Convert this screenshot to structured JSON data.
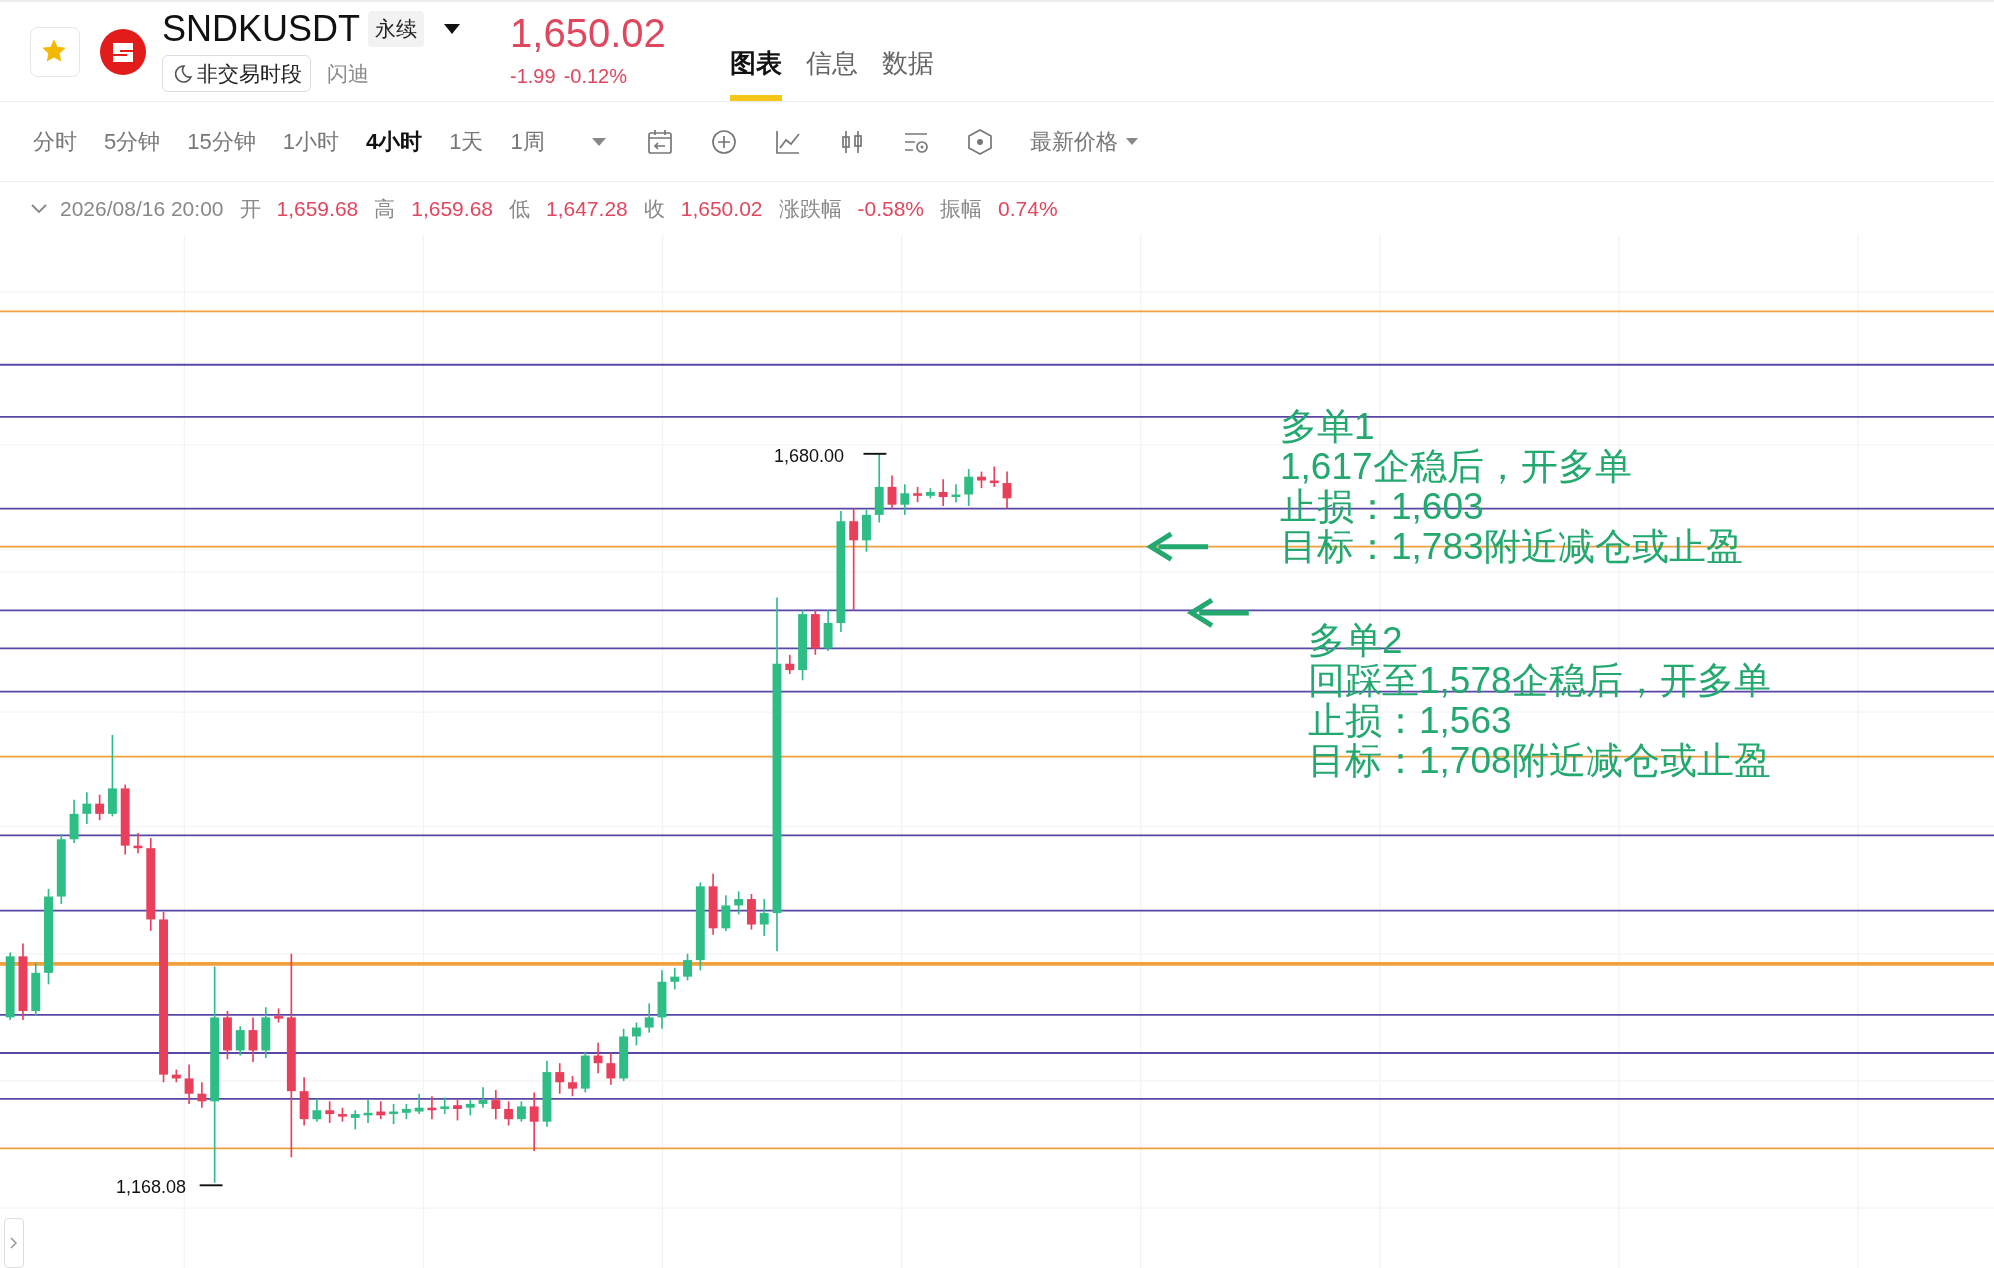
{
  "header": {
    "favorited": true,
    "symbol": "SNDKUSDT",
    "contract_type": "永续",
    "market_status": "非交易时段",
    "name": "闪迪",
    "price": "1,650.02",
    "change": "-1.99",
    "change_percent": "-0.12%"
  },
  "tabs": [
    {
      "label": "图表",
      "selected": true
    },
    {
      "label": "信息",
      "selected": false
    },
    {
      "label": "数据",
      "selected": false
    }
  ],
  "intervals": [
    {
      "label": "分时",
      "selected": false
    },
    {
      "label": "5分钟",
      "selected": false
    },
    {
      "label": "15分钟",
      "selected": false
    },
    {
      "label": "1小时",
      "selected": false
    },
    {
      "label": "4小时",
      "selected": true
    },
    {
      "label": "1天",
      "selected": false
    },
    {
      "label": "1周",
      "selected": false
    }
  ],
  "price_type": "最新价格",
  "ohlc_bar": {
    "time": "2026/08/16 20:00",
    "fields": [
      {
        "label": "开",
        "value": "1,659.68"
      },
      {
        "label": "高",
        "value": "1,659.68"
      },
      {
        "label": "低",
        "value": "1,647.28"
      },
      {
        "label": "收",
        "value": "1,650.02"
      },
      {
        "label": "涨跌幅",
        "value": "-0.58%"
      },
      {
        "label": "振幅",
        "value": "0.74%"
      }
    ]
  },
  "chart": {
    "high_label": "1,680.00",
    "low_label": "1,168.08",
    "annotations": [
      {
        "lines": [
          "多单1",
          "1,617企稳后，开多单",
          "止损：1,603",
          "目标：1,783附近减仓或止盈"
        ]
      },
      {
        "lines": [
          "多单2",
          "回踩至1,578企稳后，开多单",
          "止损：1,563",
          "目标：1,708附近减仓或止盈"
        ]
      }
    ]
  }
}
